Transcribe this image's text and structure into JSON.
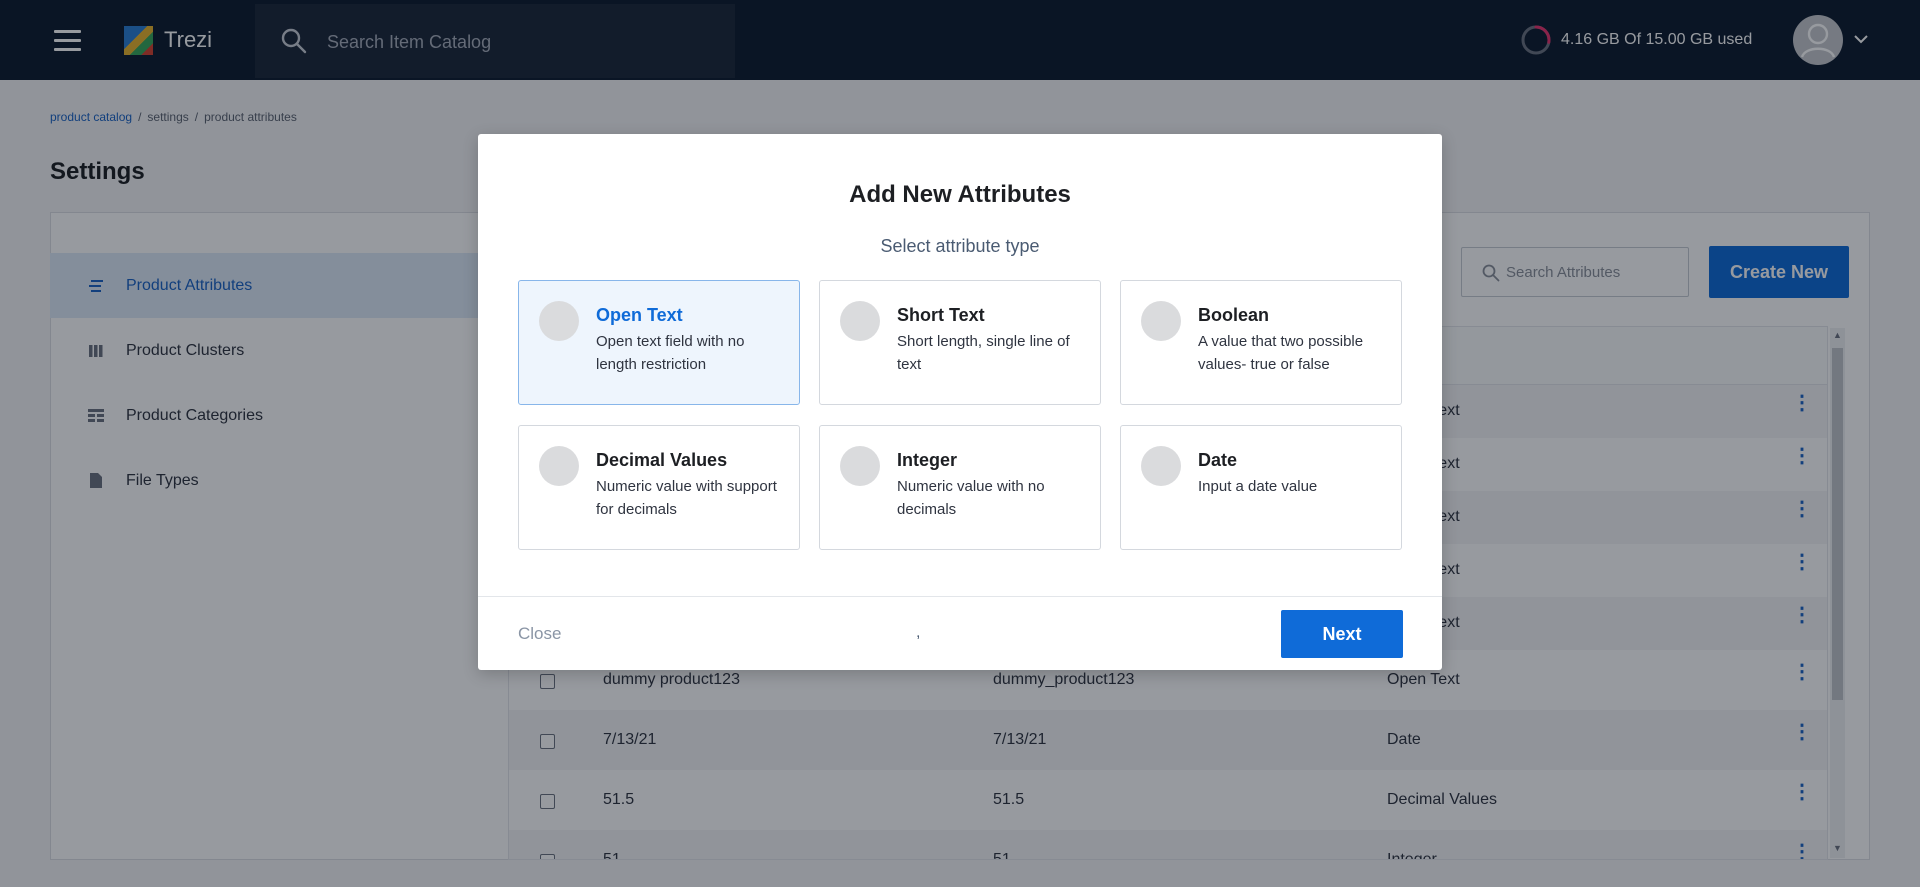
{
  "header": {
    "logo_text": "Trezi",
    "search_placeholder": "Search Item Catalog",
    "storage_text": "4.16 GB Of 15.00 GB used",
    "storage_used_fraction": 0.277
  },
  "breadcrumb": {
    "items": [
      "product catalog",
      "settings",
      "product attributes"
    ],
    "separator": "/"
  },
  "page": {
    "title": "Settings"
  },
  "sidebar": {
    "items": [
      {
        "label": "Product Attributes",
        "icon": "list-lines-icon",
        "active": true
      },
      {
        "label": "Product Clusters",
        "icon": "columns-icon",
        "active": false
      },
      {
        "label": "Product Categories",
        "icon": "table-icon",
        "active": false
      },
      {
        "label": "File Types",
        "icon": "file-icon",
        "active": false
      }
    ]
  },
  "main": {
    "search_placeholder": "Search Attributes",
    "create_button": "Create New",
    "rows": [
      {
        "name": "",
        "key": "",
        "type": "Open Text"
      },
      {
        "name": "",
        "key": "",
        "type": "Open Text"
      },
      {
        "name": "",
        "key": "",
        "type": "Open Text"
      },
      {
        "name": "",
        "key": "",
        "type": "Open Text"
      },
      {
        "name": "",
        "key": "",
        "type": "Open Text"
      },
      {
        "name": "dummy product123",
        "key": "dummy_product123",
        "type": "Open Text"
      },
      {
        "name": "7/13/21",
        "key": "7/13/21",
        "type": "Date"
      },
      {
        "name": "51.5",
        "key": "51.5",
        "type": "Decimal Values"
      },
      {
        "name": "51",
        "key": "51",
        "type": "Integer"
      }
    ]
  },
  "modal": {
    "title": "Add New Attributes",
    "subtitle": "Select attribute type",
    "types": [
      {
        "title": "Open Text",
        "description": "Open text field with no length restriction",
        "selected": true
      },
      {
        "title": "Short Text",
        "description": "Short length, single line of text",
        "selected": false
      },
      {
        "title": "Boolean",
        "description": "A value that two possible values- true or false",
        "selected": false
      },
      {
        "title": "Decimal Values",
        "description": "Numeric value with support for decimals",
        "selected": false
      },
      {
        "title": "Integer",
        "description": "Numeric value with no decimals",
        "selected": false
      },
      {
        "title": "Date",
        "description": "Input a date value",
        "selected": false
      }
    ],
    "close_label": "Close",
    "center_text": ",",
    "next_label": "Next"
  },
  "colors": {
    "topbar": "#0d1b2e",
    "accent": "#0f6bd8",
    "storage_ring": "#e8336d"
  }
}
